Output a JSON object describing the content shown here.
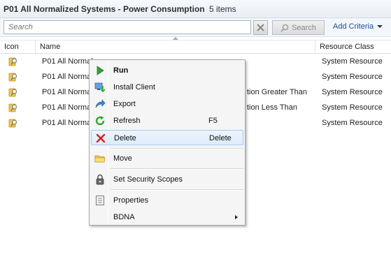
{
  "window": {
    "title": "P01 All Normalized Systems - Power Consumption",
    "item_count": "5 items"
  },
  "search": {
    "placeholder": "Search",
    "search_button": "Search",
    "add_criteria": "Add Criteria"
  },
  "columns": [
    "Icon",
    "Name",
    "Resource Class"
  ],
  "rows": [
    {
      "name": "P01 All Normal",
      "tail": "",
      "resource_class": "System Resource"
    },
    {
      "name": "P01 All Normal",
      "tail": "",
      "resource_class": "System Resource"
    },
    {
      "name": "P01 All Normal",
      "tail": "tion Greater Than",
      "resource_class": "System Resource"
    },
    {
      "name": "P01 All Normal",
      "tail": "tion Less Than",
      "resource_class": "System Resource"
    },
    {
      "name": "P01 All Normal",
      "tail": "",
      "resource_class": "System Resource"
    }
  ],
  "context_menu": {
    "items": [
      {
        "label": "Run",
        "shortcut": "",
        "icon": "run-icon"
      },
      {
        "label": "Install Client",
        "shortcut": "",
        "icon": "install-client-icon"
      },
      {
        "label": "Export",
        "shortcut": "",
        "icon": "export-icon"
      },
      {
        "label": "Refresh",
        "shortcut": "F5",
        "icon": "refresh-icon"
      },
      {
        "label": "Delete",
        "shortcut": "Delete",
        "icon": "delete-icon"
      },
      {
        "label": "Move",
        "shortcut": "",
        "icon": "folder-icon"
      },
      {
        "label": "Set Security Scopes",
        "shortcut": "",
        "icon": "lock-icon"
      },
      {
        "label": "Properties",
        "shortcut": "",
        "icon": "properties-icon"
      },
      {
        "label": "BDNA",
        "shortcut": "",
        "icon": ""
      }
    ]
  },
  "colors": {
    "link": "#1f4e9c",
    "highlight_border": "#a8c9ee",
    "run_green": "#2ea82e",
    "delete_red": "#d42020"
  }
}
